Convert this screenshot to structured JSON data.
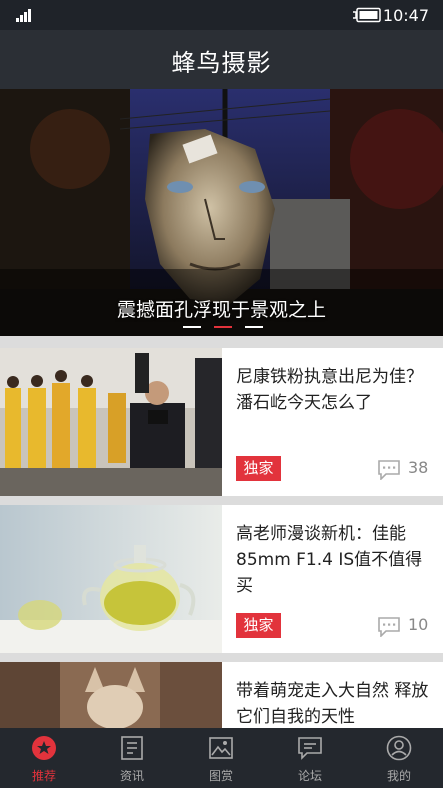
{
  "status": {
    "time": "10:47"
  },
  "header": {
    "title": "蜂鸟摄影"
  },
  "hero": {
    "caption": "震撼面孔浮现于景观之上",
    "slides": 3,
    "active_slide": 1
  },
  "feed": [
    {
      "title": "尼康铁粉执意出尼为佳？潘石屹今天怎么了",
      "badge": "独家",
      "comments": "38"
    },
    {
      "title": "高老师漫谈新机：佳能85mm F1.4 IS值不值得买",
      "badge": "独家",
      "comments": "10"
    },
    {
      "title": "带着萌宠走入大自然 释放它们自我的天性",
      "badge": "",
      "comments": ""
    }
  ],
  "tabs": [
    {
      "label": "推荐",
      "icon": "star-icon",
      "active": true
    },
    {
      "label": "资讯",
      "icon": "news-icon",
      "active": false
    },
    {
      "label": "图赏",
      "icon": "image-icon",
      "active": false
    },
    {
      "label": "论坛",
      "icon": "chat-icon",
      "active": false
    },
    {
      "label": "我的",
      "icon": "user-icon",
      "active": false
    }
  ],
  "colors": {
    "accent": "#e2333c",
    "header_bg": "#2b2f35",
    "tab_bg": "#24282e"
  }
}
